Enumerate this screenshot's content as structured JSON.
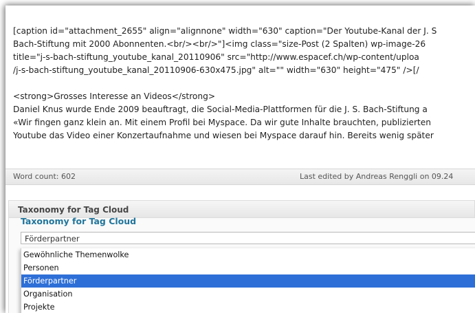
{
  "editor": {
    "lines": [
      "[caption id=\"attachment_2655\" align=\"alignnone\" width=\"630\" caption=\"Der Youtube-Kanal der J. S",
      "Bach-Stiftung mit 2000 Abonnenten.<br/><br/>\"]<img class=\"size-Post (2 Spalten) wp-image-26",
      "title=\"j-s-bach-stiftung_youtube_kanal_20110906\" src=\"http://www.espacef.ch/wp-content/uploa",
      "/j-s-bach-stiftung_youtube_kanal_20110906-630x475.jpg\" alt=\"\" width=\"630\" height=\"475\" />[/",
      "",
      "<strong>Grosses Interesse an Videos</strong>",
      "Daniel Knus wurde Ende 2009 beauftragt, die Social-Media-Plattformen für die J. S. Bach-Stiftung a",
      "«Wir fingen ganz klein an. Mit einem Profil bei Myspace. Da wir gute Inhalte brauchten, publizierten",
      "Youtube das Video einer Konzertaufnahme und wiesen bei Myspace darauf hin. Bereits wenig später"
    ]
  },
  "status": {
    "word_count": "Word count: 602",
    "last_edited": "Last edited by Andreas Renggli on 09.24"
  },
  "taxonomy": {
    "panel_title": "Taxonomy for Tag Cloud",
    "section_title": "Taxonomy for Tag Cloud",
    "selected": "Förderpartner",
    "options": [
      "Gewöhnliche Themenwolke",
      "Personen",
      "Förderpartner",
      "Organisation",
      "Projekte"
    ],
    "selected_index": 2
  },
  "colors": {
    "selection": "#2e6fd7",
    "link_blue": "#21759b"
  }
}
